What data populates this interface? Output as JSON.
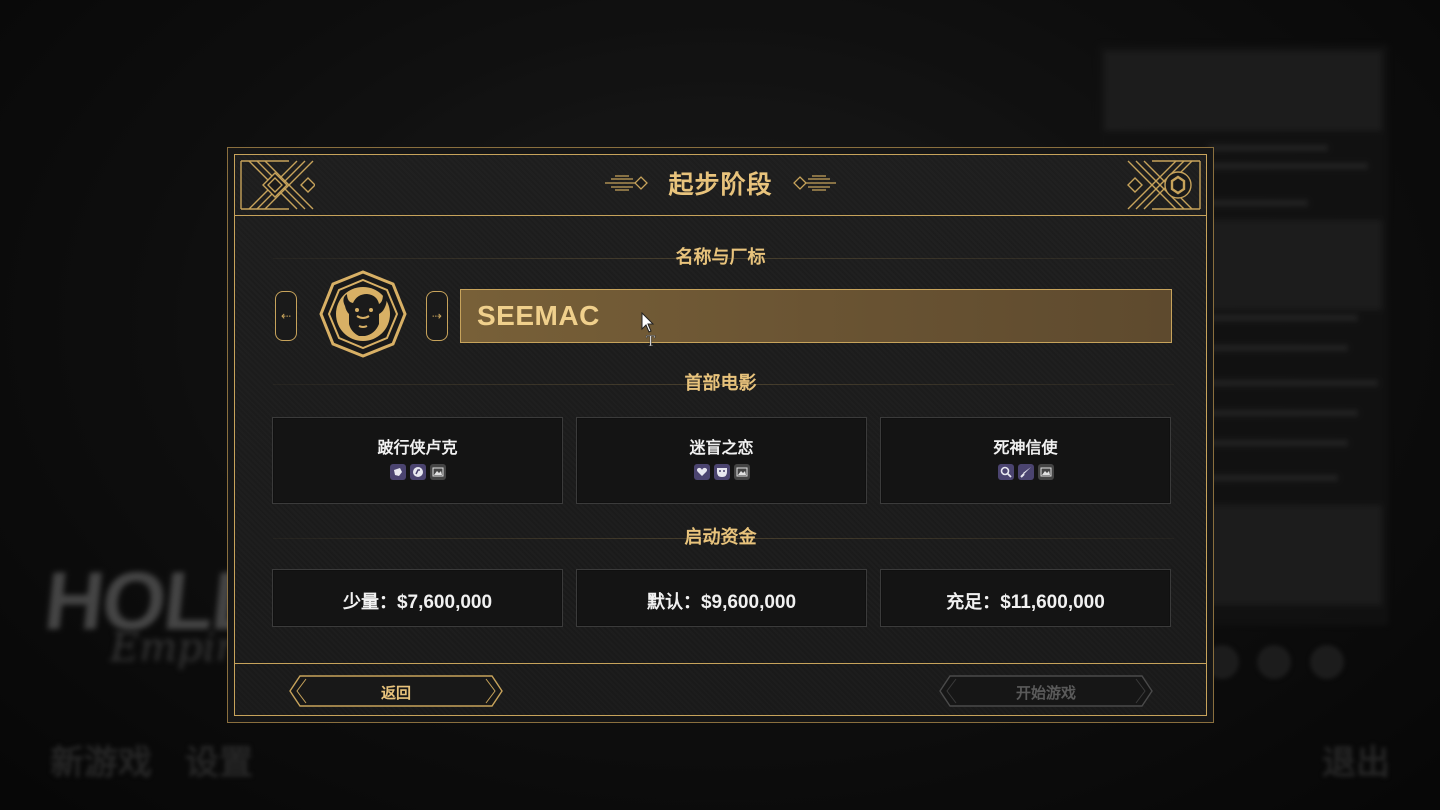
{
  "background": {
    "logo_text": "HOLLYW",
    "logo_script": "Empire",
    "menu": {
      "new_game": "新游戏",
      "settings": "设置",
      "quit": "退出"
    }
  },
  "dialog": {
    "title": "起步阶段",
    "name_section": {
      "label": "名称与厂标",
      "studio_name": "SEEMAC",
      "logo_icon": "bison-head-icon"
    },
    "first_movie": {
      "label": "首部电影",
      "options": [
        {
          "name": "跛行侠卢克",
          "genres": [
            "western-icon",
            "adventure-icon",
            "picture-icon"
          ]
        },
        {
          "name": "迷盲之恋",
          "genres": [
            "heart-icon",
            "drama-mask-icon",
            "picture-icon"
          ]
        },
        {
          "name": "死神信使",
          "genres": [
            "magnifier-icon",
            "knife-icon",
            "picture-icon"
          ]
        }
      ]
    },
    "funding": {
      "label": "启动资金",
      "options": [
        {
          "label": "少量：",
          "amount": "$7,600,000"
        },
        {
          "label": "默认：",
          "amount": "$9,600,000"
        },
        {
          "label": "充足：",
          "amount": "$11,600,000"
        }
      ]
    },
    "back_label": "返回",
    "start_label": "开始游戏"
  },
  "colors": {
    "gold": "#c7a35b",
    "gold_text": "#e8c37c",
    "genre_icon_bg": "#4b4470",
    "disabled_text": "#5a5a5a"
  }
}
